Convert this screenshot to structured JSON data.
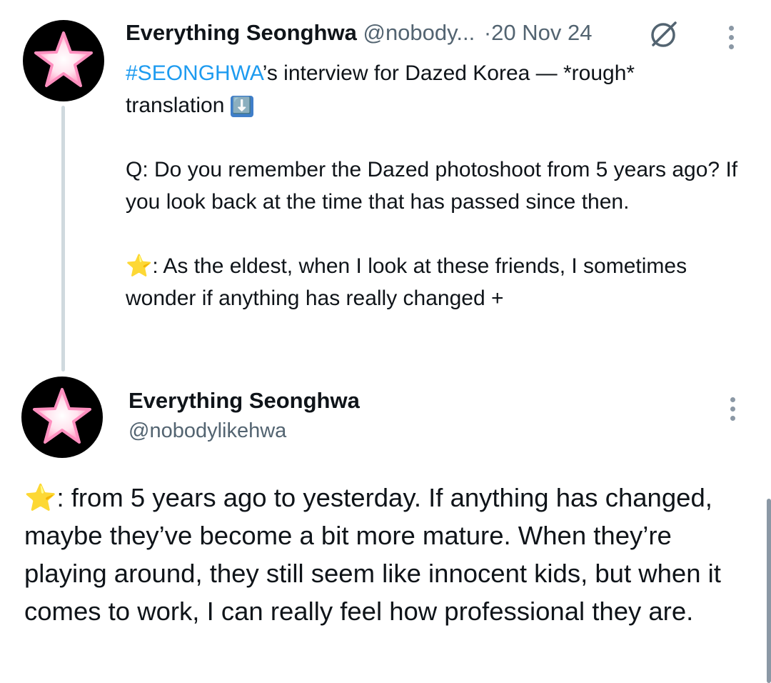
{
  "tweet1": {
    "author_name": "Everything Seonghwa",
    "handle": "@nobody...",
    "separator": "·",
    "date": "20 Nov 24",
    "hashtag": "#SEONGHWA",
    "line1_rest": "’s interview for Dazed Korea — *rough*",
    "line2": "translation",
    "line2_emoji": "⬇️",
    "question": "Q: Do you remember the Dazed photoshoot from 5 years ago? If you look back at the time that has passed since then.",
    "answer_emoji": "⭐",
    "answer": ": As the eldest, when I look at these friends, I sometimes wonder if anything has really changed +"
  },
  "tweet2": {
    "author_name": "Everything Seonghwa",
    "handle": "@nobodylikehwa",
    "body_emoji": "⭐",
    "body": ": from 5 years ago to yesterday. If anything has changed, maybe they’ve become a bit more mature. When they’re playing around, they still seem like innocent kids, but when it comes to work, I can really feel how professional they are."
  },
  "colors": {
    "link": "#1d9bf0",
    "muted": "#536471",
    "thread_line": "#cfd9de",
    "avatar_star": "#ffd6e6"
  },
  "icons": [
    "star-avatar-icon",
    "no-entry-icon",
    "more-options-icon",
    "down-arrow-emoji",
    "star-emoji"
  ]
}
